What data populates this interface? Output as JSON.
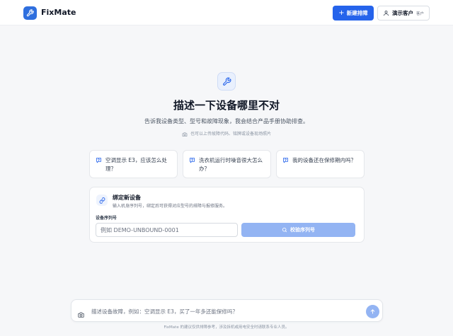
{
  "header": {
    "brand": "FixMate",
    "new_ticket_label": "新建排障",
    "user_name": "演示客户",
    "user_role": "客户"
  },
  "hero": {
    "title": "描述一下设备哪里不对",
    "subtitle": "告诉我设备类型、型号和故障现象，我会结合产品手册协助排查。",
    "hint": "也可以上传故障代码、铭牌或设备现场照片"
  },
  "suggestions": [
    {
      "text": "空调显示 E3，应该怎么处理？"
    },
    {
      "text": "洗衣机运行时噪音很大怎么办？"
    },
    {
      "text": "我的设备还在保修期内吗？"
    }
  ],
  "bind_device": {
    "title": "绑定新设备",
    "description": "输入机身序列号，绑定后可获得对应型号的排障与报修服务。",
    "serial_label": "设备序列号",
    "serial_placeholder": "例如 DEMO-UNBOUND-0001",
    "verify_label": "校验序列号"
  },
  "composer": {
    "placeholder": "描述设备故障，例如：空调显示 E3，买了一年多还能保修吗？"
  },
  "footer": {
    "disclaimer": "FixMate 的建议仅供排障参考，涉及拆机或用电安全时请联系专业人员。"
  },
  "colors": {
    "accent": "#2563eb",
    "accent_disabled": "#93b4f3",
    "background": "#f6f7f9"
  }
}
